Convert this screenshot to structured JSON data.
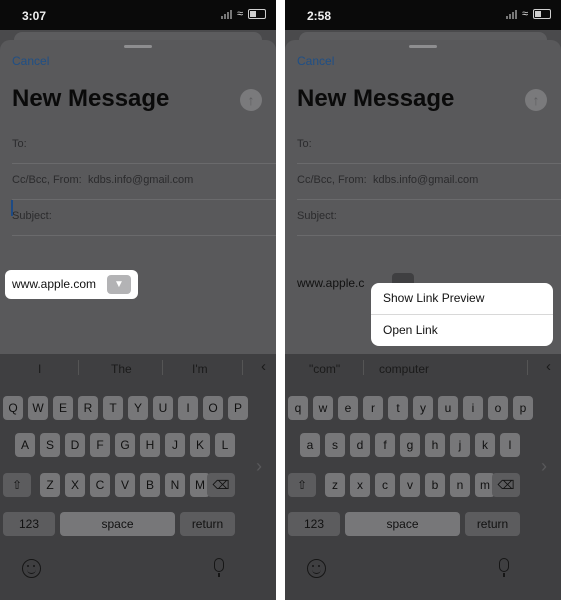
{
  "left": {
    "status": {
      "time": "3:07"
    },
    "cancel": "Cancel",
    "title": "New Message",
    "to_label": "To:",
    "ccbcc_label": "Cc/Bcc, From:",
    "from_email": "kdbs.info@gmail.com",
    "subject_label": "Subject:",
    "link_text": "www.apple.com",
    "predictions": [
      "I",
      "The",
      "I'm"
    ]
  },
  "right": {
    "status": {
      "time": "2:58"
    },
    "cancel": "Cancel",
    "title": "New Message",
    "to_label": "To:",
    "ccbcc_label": "Cc/Bcc, From:",
    "from_email": "kdbs.info@gmail.com",
    "subject_label": "Subject:",
    "link_text": "www.apple.c",
    "menu": [
      "Show Link Preview",
      "Open Link"
    ],
    "predictions": [
      "\"com\"",
      "computer"
    ]
  },
  "keyboard": {
    "left_rows": [
      [
        "Q",
        "W",
        "E",
        "R",
        "T",
        "Y",
        "U",
        "I",
        "O",
        "P"
      ],
      [
        "A",
        "S",
        "D",
        "F",
        "G",
        "H",
        "J",
        "K",
        "L"
      ],
      [
        "Z",
        "X",
        "C",
        "V",
        "B",
        "N",
        "M"
      ]
    ],
    "right_rows": [
      [
        "q",
        "w",
        "e",
        "r",
        "t",
        "y",
        "u",
        "i",
        "o",
        "p"
      ],
      [
        "a",
        "s",
        "d",
        "f",
        "g",
        "h",
        "j",
        "k",
        "l"
      ],
      [
        "z",
        "x",
        "c",
        "v",
        "b",
        "n",
        "m"
      ]
    ],
    "numbers": "123",
    "space": "space",
    "return": "return",
    "shift_symbol": "⇧",
    "delete_symbol": "⌫"
  },
  "icons": {
    "send": "arrow-up-icon",
    "chevron": "chevron-down-icon",
    "back": "chevron-left-icon",
    "edge": "chevron-right-icon",
    "emoji": "emoji-icon",
    "mic": "microphone-icon",
    "wifi": "wifi-icon",
    "battery": "battery-icon"
  },
  "colors": {
    "accent": "#1f4f86",
    "overlay": "#59595b",
    "keyboard": "#3f3f41"
  }
}
